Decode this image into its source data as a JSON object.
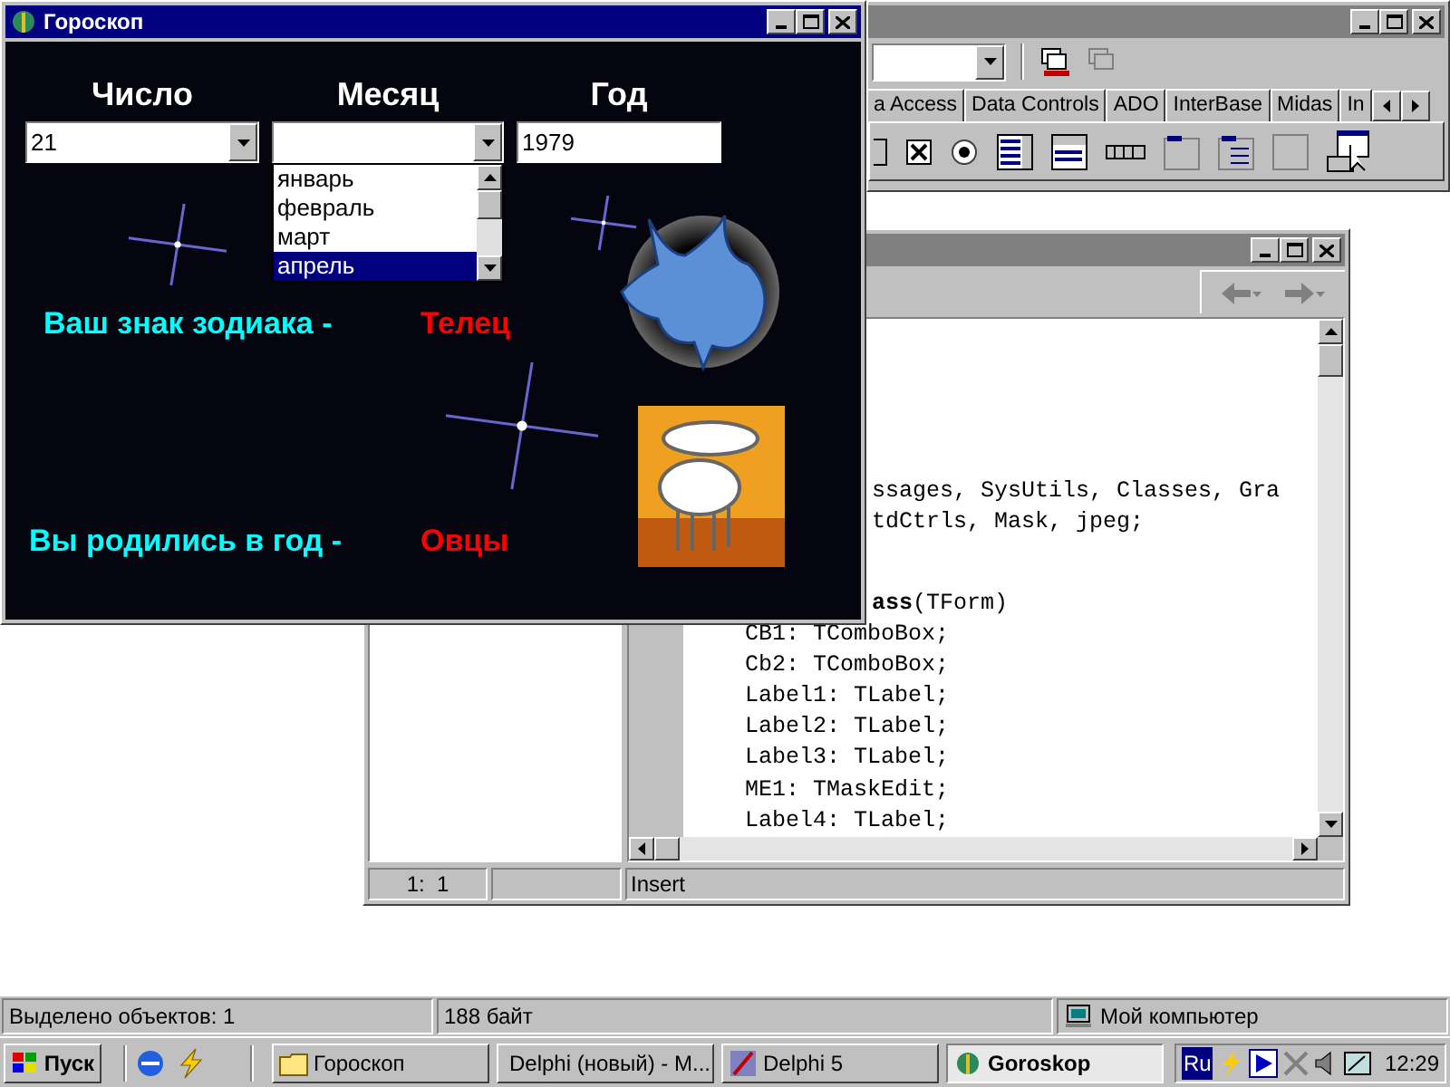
{
  "horoscope_window": {
    "title": "Гороскоп",
    "headings": [
      "Число",
      "Месяц",
      "Год"
    ],
    "day_combo": {
      "value": "21"
    },
    "month_combo": {
      "expanded": true
    },
    "month_list": [
      {
        "label": "январь",
        "selected": false
      },
      {
        "label": "февраль",
        "selected": false
      },
      {
        "label": "март",
        "selected": false
      },
      {
        "label": "апрель",
        "selected": true
      }
    ],
    "year_field": {
      "value": "1979"
    },
    "results": [
      {
        "kind": "zodiac",
        "label": "Ваш знак зодиака -",
        "value": "Телец"
      },
      {
        "kind": "year",
        "label": "Вы родились в год -",
        "value": "Овцы"
      }
    ]
  },
  "ide_window": {
    "palette_tabs": [
      {
        "label": "a Access",
        "selected": false
      },
      {
        "label": "Data Controls",
        "selected": false
      },
      {
        "label": "ADO",
        "selected": false
      },
      {
        "label": "InterBase",
        "selected": false
      },
      {
        "label": "Midas",
        "selected": false
      },
      {
        "label": "In",
        "selected": false
      }
    ]
  },
  "editor_window": {
    "code_lines": [
      {
        "kind": "cut",
        "text": "ssages, SysUtils, Classes, Gra"
      },
      {
        "kind": "cut",
        "text": "tdCtrls, Mask, jpeg;"
      },
      {
        "kind": "blank"
      },
      {
        "kind": "blank"
      },
      {
        "kind": "cut",
        "text": "**ass**(TForm)"
      },
      {
        "kind": "member",
        "text": "CB1: TComboBox;"
      },
      {
        "kind": "member",
        "text": "Cb2: TComboBox;"
      },
      {
        "kind": "member",
        "text": "Label1: TLabel;"
      },
      {
        "kind": "member",
        "text": "Label2: TLabel;"
      },
      {
        "kind": "member",
        "text": "Label3: TLabel;"
      },
      {
        "kind": "member",
        "text": "ME1: TMaskEdit;"
      },
      {
        "kind": "member",
        "text": "Label4: TLabel;"
      }
    ],
    "status": {
      "position": "1:  1",
      "mode": "Insert"
    }
  },
  "explorer_status": [
    "Выделено объектов: 1",
    "188 байт",
    "Мой компьютер"
  ],
  "taskbar": {
    "start_label": "Пуск",
    "tasks": [
      {
        "kind": "folder",
        "label": "Гороскоп",
        "selected": false
      },
      {
        "kind": "document",
        "label": "Delphi (новый) - M...",
        "selected": false
      },
      {
        "kind": "delphi",
        "label": "Delphi 5",
        "selected": false
      },
      {
        "kind": "app",
        "label": "Goroskop",
        "selected": true
      }
    ],
    "language": "Ru",
    "clock": "12:29"
  }
}
